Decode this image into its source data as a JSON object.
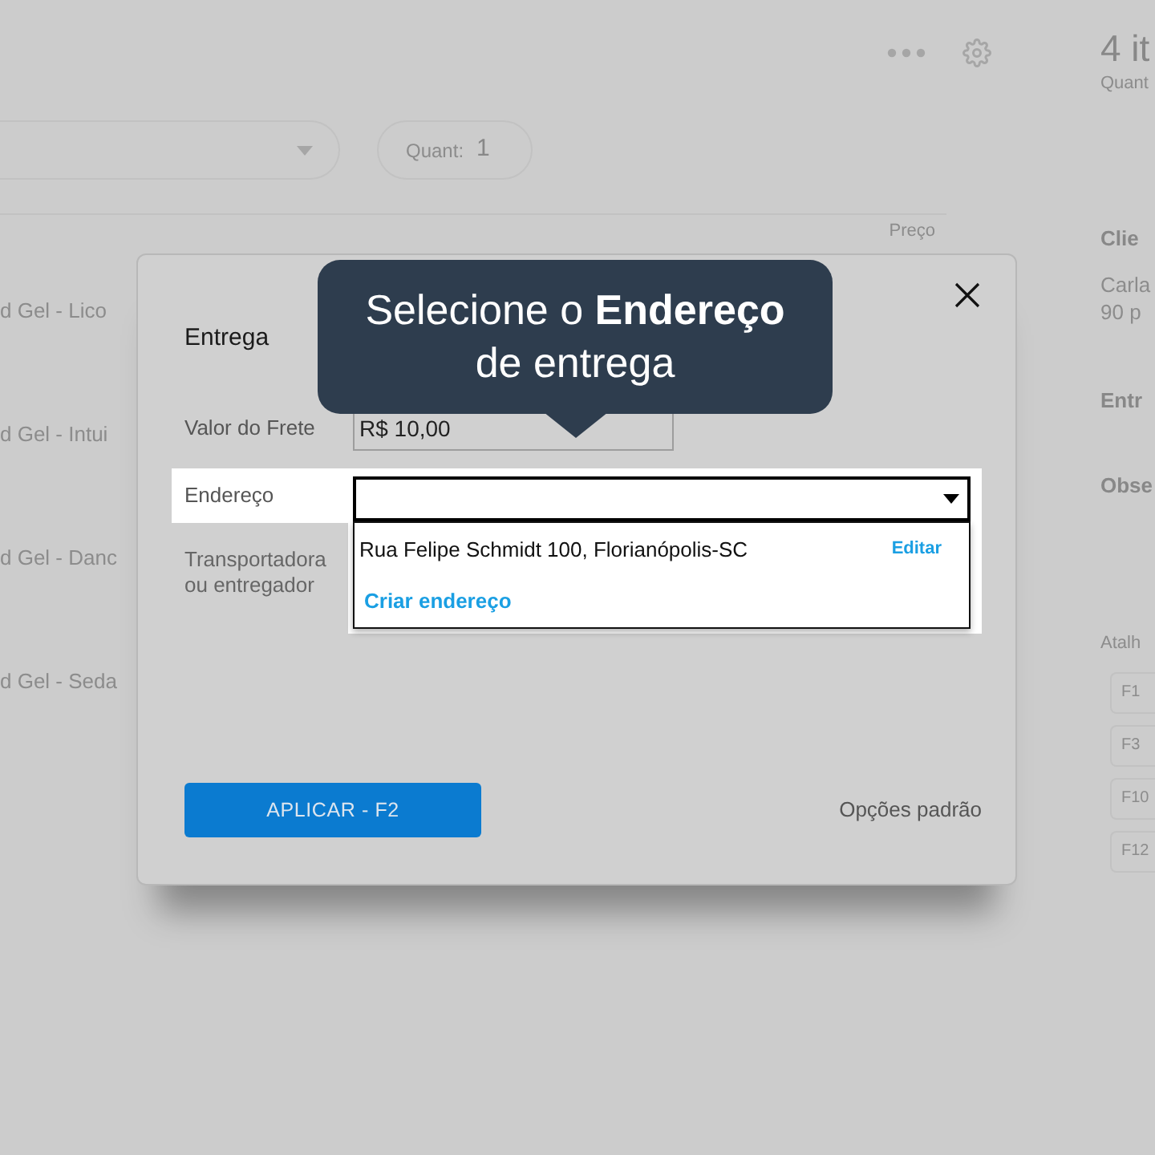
{
  "background": {
    "quantity": {
      "label": "Quant:",
      "value": "1"
    },
    "column_header": "Preço",
    "products": [
      "d Gel - Lico",
      "d Gel - Intui",
      "d Gel - Danc",
      "d Gel - Seda"
    ],
    "summary": {
      "title": "4 it",
      "subtitle": "Quant"
    },
    "sections": [
      {
        "title": "Clie",
        "lines": [
          "Carla",
          "90 p"
        ]
      },
      {
        "title": "Entr"
      },
      {
        "title": "Obse"
      }
    ],
    "shortcuts": {
      "title": "Atalh",
      "keys": [
        "F1",
        "F3",
        "F10",
        "F12"
      ]
    }
  },
  "dialog": {
    "title": "Entrega",
    "fields": [
      {
        "label": "Valor do Frete",
        "value": "R$ 10,00"
      }
    ],
    "address": {
      "label": "Endereço",
      "expanded": true,
      "options": [
        {
          "text": "Rua Felipe Schmidt 100, Florianópolis-SC",
          "action": "Editar"
        }
      ],
      "create_link": "Criar endereço"
    },
    "carrier_label": "Transportadora ou entregador",
    "apply_button": "APLICAR - F2",
    "defaults_link": "Opções padrão"
  },
  "tooltip": {
    "text": "Selecione o **Endereço** de entrega"
  }
}
